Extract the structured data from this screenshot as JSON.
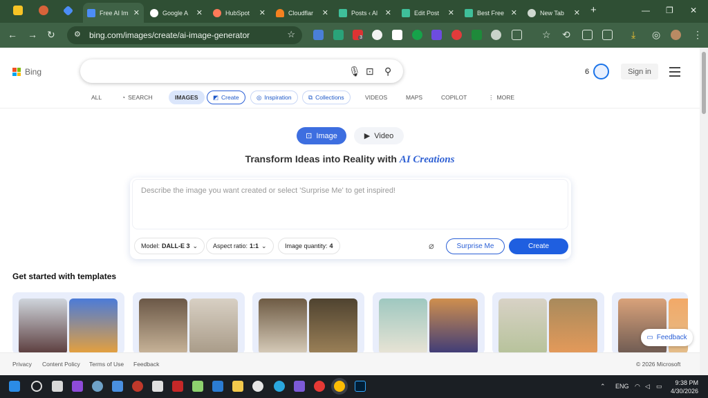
{
  "browser": {
    "tabs": [
      {
        "label": "Free AI Im",
        "active": true
      },
      {
        "label": "Google A",
        "active": false
      },
      {
        "label": "HubSpot",
        "active": false
      },
      {
        "label": "Cloudflar",
        "active": false
      },
      {
        "label": "Posts ‹ Al",
        "active": false
      },
      {
        "label": "Edit Post",
        "active": false
      },
      {
        "label": "Best Free",
        "active": false
      },
      {
        "label": "New Tab",
        "active": false
      }
    ],
    "url": "bing.com/images/create/ai-image-generator",
    "extension_badge": "3"
  },
  "header": {
    "logo_text": "Bing",
    "rewards_count": "6",
    "sign_in": "Sign in"
  },
  "nav": {
    "all": "ALL",
    "search": "SEARCH",
    "images": "IMAGES",
    "create": "Create",
    "inspiration": "Inspiration",
    "collections": "Collections",
    "videos": "VIDEOS",
    "maps": "MAPS",
    "copilot": "COPILOT",
    "more": "MORE"
  },
  "mode": {
    "image": "Image",
    "video": "Video"
  },
  "headline": {
    "main": "Transform Ideas into Reality with",
    "accent": "AI Creations"
  },
  "prompt": {
    "placeholder": "Describe the image you want created or select 'Surprise Me' to get inspired!",
    "model_label": "Model:",
    "model_value": "DALL-E 3",
    "aspect_label": "Aspect ratio:",
    "aspect_value": "1:1",
    "quantity_label": "Image quantity:",
    "quantity_value": "4",
    "surprise": "Surprise Me",
    "create": "Create"
  },
  "templates": {
    "title": "Get started with templates"
  },
  "feedback": "Feedback",
  "footer": {
    "privacy": "Privacy",
    "content_policy": "Content Policy",
    "terms": "Terms of Use",
    "feedback": "Feedback",
    "copyright": "© 2026 Microsoft"
  },
  "taskbar": {
    "language": "ENG",
    "time": "9:38 PM",
    "date": "4/30/2026"
  },
  "colors": {
    "accent": "#1f5fe0",
    "chrome": "#2f4f34"
  }
}
